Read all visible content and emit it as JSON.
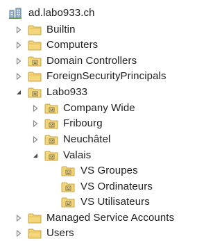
{
  "tree": {
    "root": {
      "label": "ad.labo933.ch",
      "icon": "domain-icon"
    },
    "items": [
      {
        "label": "Builtin",
        "icon": "folder-icon",
        "expanded": false
      },
      {
        "label": "Computers",
        "icon": "folder-icon",
        "expanded": false
      },
      {
        "label": "Domain Controllers",
        "icon": "ou-icon",
        "expanded": false
      },
      {
        "label": "ForeignSecurityPrincipals",
        "icon": "folder-icon",
        "expanded": false
      },
      {
        "label": "Labo933",
        "icon": "ou-icon",
        "expanded": true,
        "children": [
          {
            "label": "Company Wide",
            "icon": "ou-icon",
            "expanded": false
          },
          {
            "label": "Fribourg",
            "icon": "ou-icon",
            "expanded": false
          },
          {
            "label": "Neuchâtel",
            "icon": "ou-icon",
            "expanded": false
          },
          {
            "label": "Valais",
            "icon": "ou-icon",
            "expanded": true,
            "children": [
              {
                "label": "VS Groupes",
                "icon": "ou-icon"
              },
              {
                "label": "VS Ordinateurs",
                "icon": "ou-icon"
              },
              {
                "label": "VS Utilisateurs",
                "icon": "ou-icon"
              }
            ]
          }
        ]
      },
      {
        "label": "Managed Service Accounts",
        "icon": "folder-icon",
        "expanded": false
      },
      {
        "label": "Users",
        "icon": "folder-icon",
        "expanded": false
      }
    ]
  },
  "colors": {
    "folder_body": "#f3d57a",
    "folder_edge": "#c9a443",
    "ou_mark": "#6b5b2a",
    "toggle_collapsed": "#8a8a8a",
    "toggle_expanded": "#4a4a4a"
  }
}
